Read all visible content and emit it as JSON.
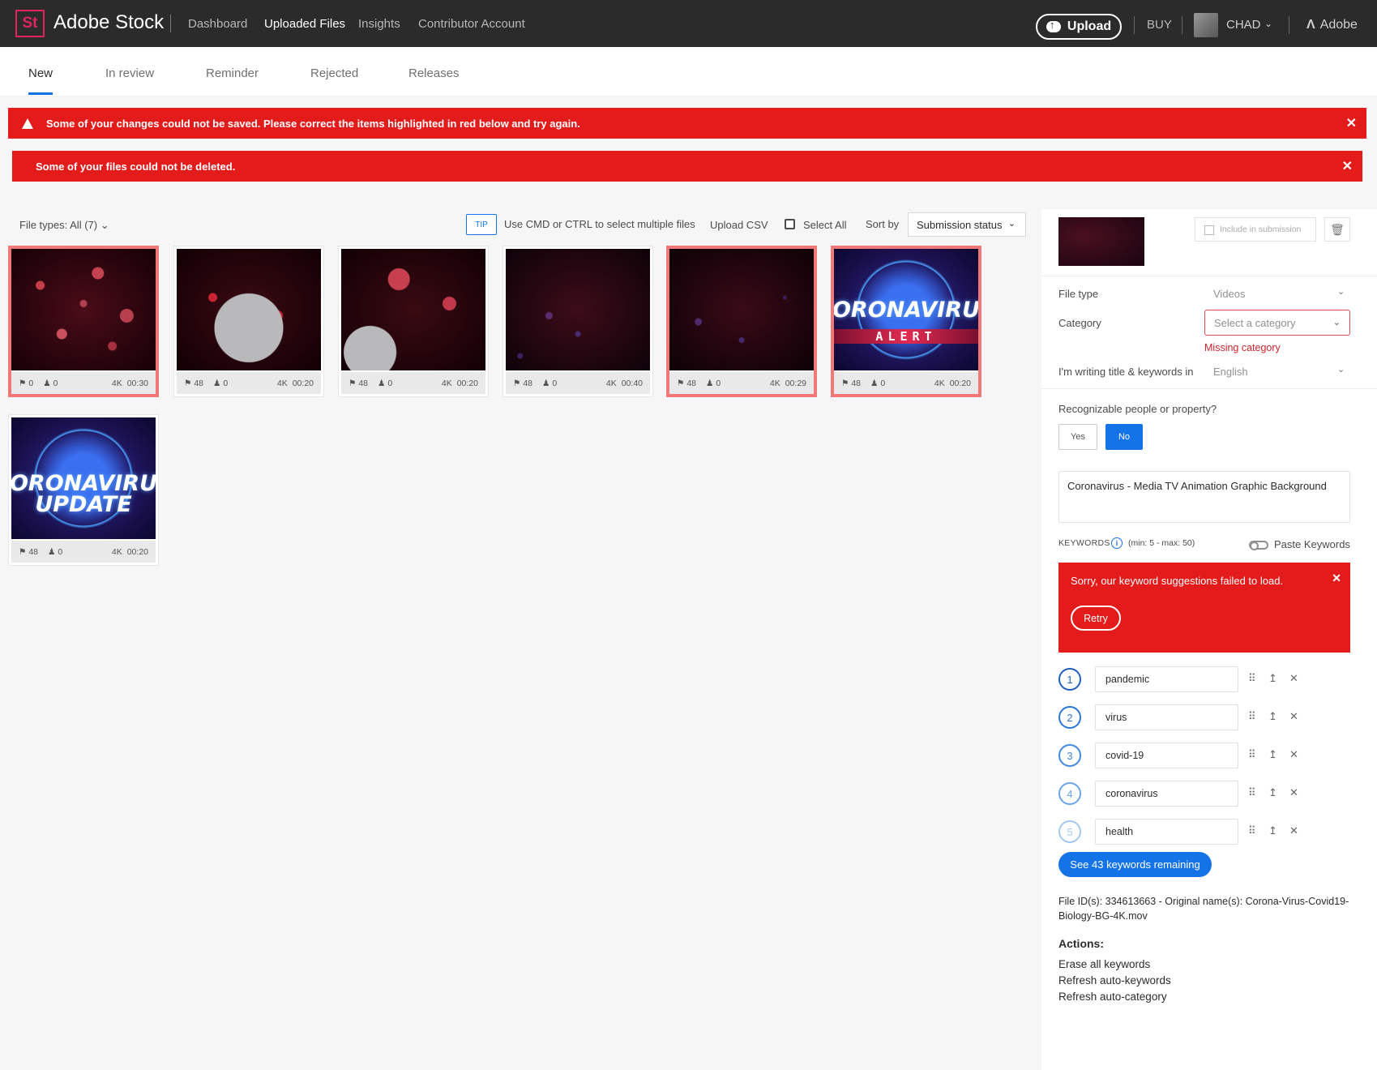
{
  "header": {
    "logo_text": "St",
    "brand": "Adobe Stock",
    "nav": [
      "Dashboard",
      "Uploaded Files",
      "Insights",
      "Contributor Account"
    ],
    "active_nav": "Uploaded Files",
    "upload_label": "Upload",
    "buy_label": "BUY",
    "user_name": "CHAD",
    "adobe_label": "Adobe"
  },
  "tabs": [
    "New",
    "In review",
    "Reminder",
    "Rejected",
    "Releases"
  ],
  "alerts": {
    "save_error": "Some of your changes could not be saved. Please correct the items highlighted in red below and try again.",
    "delete_error": "Some of your files could not be deleted."
  },
  "toolbar": {
    "file_types": "File types: All (7)",
    "tip_label": "TIP",
    "tip_text": "Use CMD or CTRL to select multiple files",
    "upload_csv": "Upload CSV",
    "select_all": "Select All",
    "sort_by": "Sort by",
    "sort_value": "Submission status"
  },
  "thumbnails": [
    {
      "keywords": "0",
      "people": "0",
      "res": "4K",
      "duration": "00:30",
      "error": true,
      "image": "virus-particles"
    },
    {
      "keywords": "48",
      "people": "0",
      "res": "4K",
      "duration": "00:20",
      "error": false,
      "image": "virus-big"
    },
    {
      "keywords": "48",
      "people": "0",
      "res": "4K",
      "duration": "00:20",
      "error": false,
      "image": "virus-corner"
    },
    {
      "keywords": "48",
      "people": "0",
      "res": "4K",
      "duration": "00:40",
      "error": false,
      "image": "dark-particles"
    },
    {
      "keywords": "48",
      "people": "0",
      "res": "4K",
      "duration": "00:29",
      "error": true,
      "image": "dark-particles-2"
    },
    {
      "keywords": "48",
      "people": "0",
      "res": "4K",
      "duration": "00:20",
      "error": true,
      "image": "news-alert",
      "overlay_top": "ORONAVIRU",
      "overlay_band": "ALERT"
    },
    {
      "keywords": "48",
      "people": "0",
      "res": "4K",
      "duration": "00:20",
      "error": false,
      "image": "news-update",
      "overlay_top": "ORONAVIRU",
      "overlay_bottom": "UPDATE"
    }
  ],
  "panel": {
    "include_label": "Include in submission",
    "file_type_label": "File type",
    "file_type_value": "Videos",
    "category_label": "Category",
    "category_placeholder": "Select a category",
    "missing_category": "Missing category",
    "language_label": "I'm writing title & keywords in",
    "language_value": "English",
    "recognizable_label": "Recognizable people or property?",
    "yes_label": "Yes",
    "no_label": "No",
    "title_value": "Coronavirus - Media TV Animation Graphic Background",
    "keywords_label": "KEYWORDS",
    "keywords_range": "(min: 5 - max: 50)",
    "paste_keywords": "Paste Keywords",
    "kw_error": "Sorry, our keyword suggestions failed to load.",
    "retry_label": "Retry",
    "keywords": [
      {
        "num": "1",
        "value": "pandemic"
      },
      {
        "num": "2",
        "value": "virus"
      },
      {
        "num": "3",
        "value": "covid-19"
      },
      {
        "num": "4",
        "value": "coronavirus"
      },
      {
        "num": "5",
        "value": "health"
      }
    ],
    "remaining_button": "See 43 keywords remaining",
    "file_ids": "File ID(s): 334613663 - Original name(s): Corona-Virus-Covid19-Biology-BG-4K.mov",
    "actions_heading": "Actions:",
    "actions": [
      "Erase all keywords",
      "Refresh auto-keywords",
      "Refresh auto-category"
    ]
  },
  "colors": {
    "accent": "#1473e6",
    "error": "#e31b1b",
    "topbar": "#2b2b2b",
    "brand": "#e0245e"
  }
}
